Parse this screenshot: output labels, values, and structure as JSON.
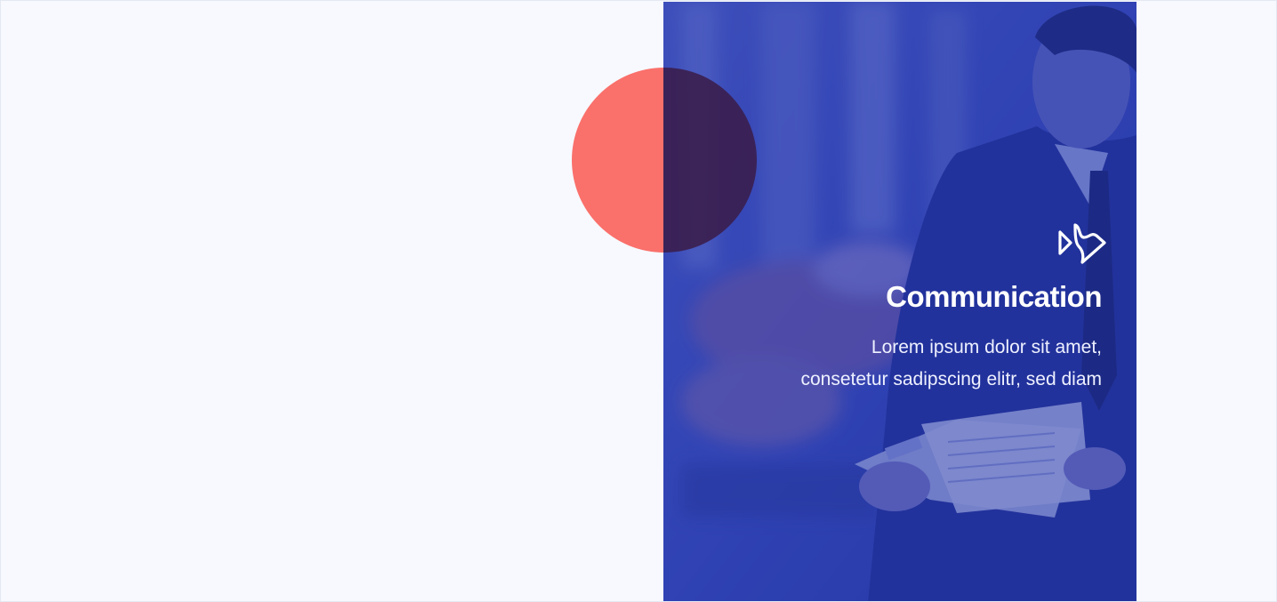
{
  "feature": {
    "icon": "play-forward-icon",
    "title": "Communication",
    "description_lines": [
      "Lorem ipsum dolor sit amet,",
      "consetetur sadipscing elitr, sed diam"
    ]
  },
  "colors": {
    "background": "#f7f9ff",
    "overlay_blue": "#2c3c9e",
    "circle_coral": "#fa706b",
    "text_white": "#ffffff"
  },
  "image": {
    "subject": "businessman-reading-document"
  }
}
